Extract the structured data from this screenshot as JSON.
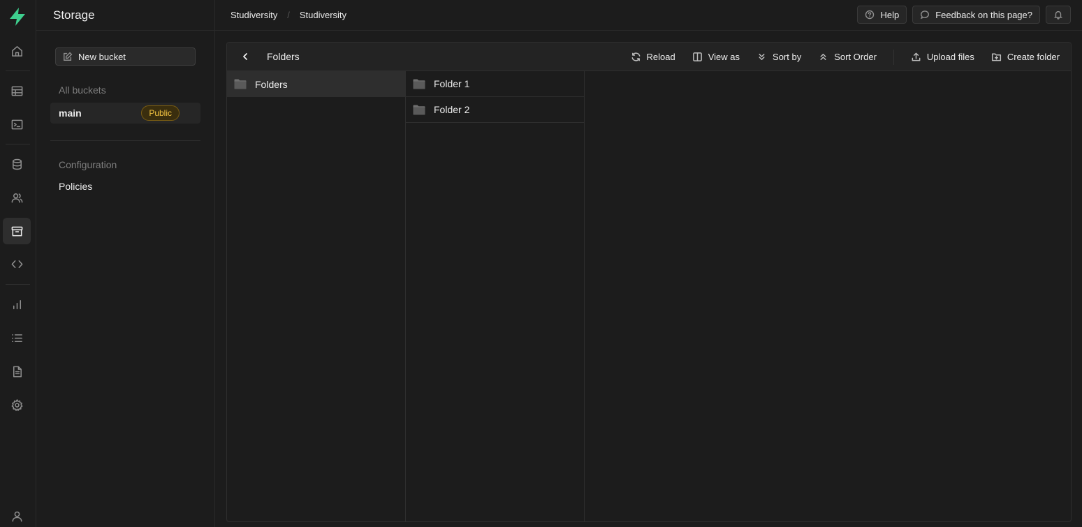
{
  "colors": {
    "brand": "#3ecf8e",
    "badge": "#f5c542",
    "background": "#1c1c1c"
  },
  "rail": {
    "icons": [
      "logo-icon",
      "home-icon",
      "table-editor-icon",
      "sql-editor-icon",
      "database-icon",
      "auth-icon",
      "storage-icon",
      "edge-functions-icon",
      "reports-icon",
      "logs-icon",
      "api-docs-icon",
      "settings-icon",
      "user-icon"
    ],
    "active": "storage-icon"
  },
  "side": {
    "title": "Storage",
    "new_bucket": "New bucket",
    "all_buckets_label": "All buckets",
    "buckets": [
      {
        "name": "main",
        "badge": "Public"
      }
    ],
    "configuration_label": "Configuration",
    "policies": "Policies"
  },
  "topbar": {
    "crumbs": [
      "Studiversity",
      "Studiversity"
    ],
    "crumb_sep": "/",
    "help": "Help",
    "feedback": "Feedback on this page?"
  },
  "explorer": {
    "title": "Folders",
    "actions": {
      "reload": "Reload",
      "view_as": "View as",
      "sort_by": "Sort by",
      "sort_order": "Sort Order",
      "upload": "Upload files",
      "create_folder": "Create folder"
    },
    "column1": [
      {
        "name": "Folders",
        "selected": true
      }
    ],
    "column2": [
      {
        "name": "Folder 1"
      },
      {
        "name": "Folder 2"
      }
    ]
  }
}
